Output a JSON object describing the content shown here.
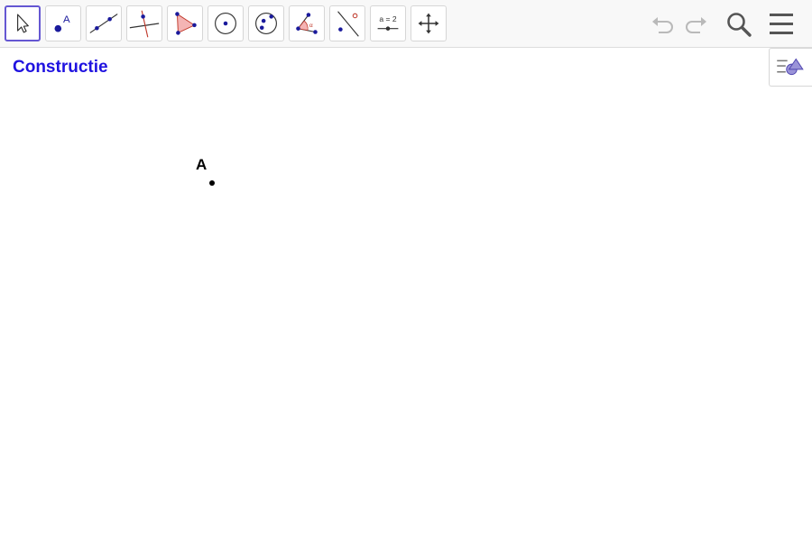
{
  "toolbar": {
    "tools": [
      {
        "name": "move",
        "icon": "arrow-cursor-icon",
        "active": true
      },
      {
        "name": "point",
        "icon": "point-icon",
        "label": "A"
      },
      {
        "name": "line",
        "icon": "line-through-two-points-icon"
      },
      {
        "name": "perpendicular",
        "icon": "perpendicular-line-icon"
      },
      {
        "name": "polygon",
        "icon": "polygon-icon"
      },
      {
        "name": "circle",
        "icon": "circle-center-point-icon"
      },
      {
        "name": "circle-three-points",
        "icon": "circle-three-points-icon"
      },
      {
        "name": "angle",
        "icon": "angle-icon",
        "label": "α"
      },
      {
        "name": "reflect",
        "icon": "reflect-about-line-icon"
      },
      {
        "name": "slider",
        "icon": "slider-icon",
        "label": "a = 2"
      },
      {
        "name": "move-graphics-view",
        "icon": "move-graphics-view-icon"
      }
    ],
    "right": [
      "undo-icon",
      "redo-icon",
      "search-icon",
      "menu-icon"
    ]
  },
  "canvas": {
    "title": "Constructie",
    "point": {
      "label": "A"
    }
  },
  "colors": {
    "title": "#1f12e0",
    "active_tool_border": "#6557d2",
    "tool_point": "#1a1a9c"
  }
}
